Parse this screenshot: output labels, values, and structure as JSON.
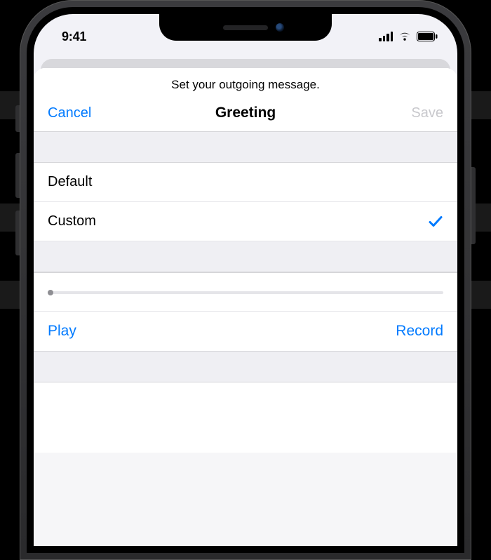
{
  "statusbar": {
    "time": "9:41"
  },
  "card": {
    "caption": "Set your outgoing message.",
    "nav": {
      "cancel": "Cancel",
      "title": "Greeting",
      "save": "Save"
    },
    "options": [
      {
        "label": "Default",
        "selected": false
      },
      {
        "label": "Custom",
        "selected": true
      }
    ],
    "progress": {
      "value": 0,
      "max": 1
    },
    "actions": {
      "play": "Play",
      "record": "Record"
    }
  },
  "colors": {
    "tint": "#007aff",
    "disabled": "#c8c8cc",
    "separator": "#d6d6d9",
    "groupbg": "#efeff3"
  }
}
